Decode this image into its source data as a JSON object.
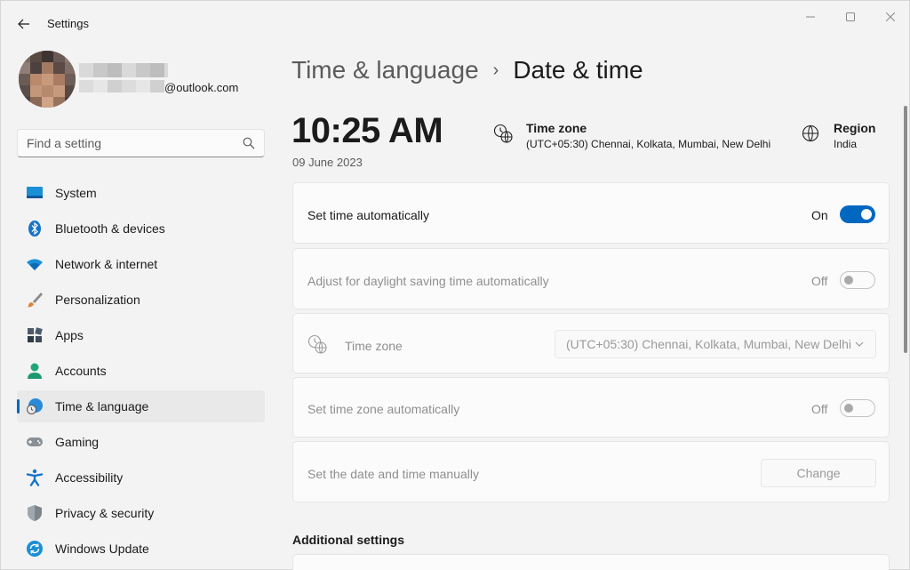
{
  "titlebar": {
    "title": "Settings",
    "back_icon": "back-arrow-icon",
    "minimize_icon": "minimize-icon",
    "maximize_icon": "maximize-icon",
    "close_icon": "close-icon"
  },
  "profile": {
    "email_suffix": "@outlook.com"
  },
  "search": {
    "placeholder": "Find a setting",
    "icon": "search-icon"
  },
  "sidebar": {
    "items": [
      {
        "label": "System",
        "icon": "system-icon",
        "active": false
      },
      {
        "label": "Bluetooth & devices",
        "icon": "bluetooth-icon",
        "active": false
      },
      {
        "label": "Network & internet",
        "icon": "wifi-icon",
        "active": false
      },
      {
        "label": "Personalization",
        "icon": "brush-icon",
        "active": false
      },
      {
        "label": "Apps",
        "icon": "apps-icon",
        "active": false
      },
      {
        "label": "Accounts",
        "icon": "accounts-icon",
        "active": false
      },
      {
        "label": "Time & language",
        "icon": "time-language-icon",
        "active": true
      },
      {
        "label": "Gaming",
        "icon": "gamepad-icon",
        "active": false
      },
      {
        "label": "Accessibility",
        "icon": "accessibility-icon",
        "active": false
      },
      {
        "label": "Privacy & security",
        "icon": "shield-icon",
        "active": false
      },
      {
        "label": "Windows Update",
        "icon": "update-icon",
        "active": false
      }
    ]
  },
  "header": {
    "parent": "Time & language",
    "separator": "›",
    "current": "Date & time"
  },
  "clock": {
    "time": "10:25 AM",
    "date": "09 June 2023"
  },
  "timezone_info": {
    "title": "Time zone",
    "value": "(UTC+05:30) Chennai, Kolkata, Mumbai, New Delhi",
    "icon": "timezone-globe-icon"
  },
  "region_info": {
    "title": "Region",
    "value": "India",
    "icon": "globe-icon"
  },
  "settings": {
    "set_time_auto": {
      "label": "Set time automatically",
      "state": "On",
      "enabled": true
    },
    "daylight_saving": {
      "label": "Adjust for daylight saving time automatically",
      "state": "Off",
      "enabled": false
    },
    "time_zone": {
      "label": "Time zone",
      "value": "(UTC+05:30) Chennai, Kolkata, Mumbai, New Delhi",
      "enabled": false
    },
    "set_tz_auto": {
      "label": "Set time zone automatically",
      "state": "Off",
      "enabled": false
    },
    "manual": {
      "label": "Set the date and time manually",
      "button": "Change",
      "enabled": false
    }
  },
  "additional": {
    "heading": "Additional settings"
  },
  "colors": {
    "accent": "#0067c0",
    "background": "#f3f3f3",
    "card": "#fbfbfb"
  }
}
